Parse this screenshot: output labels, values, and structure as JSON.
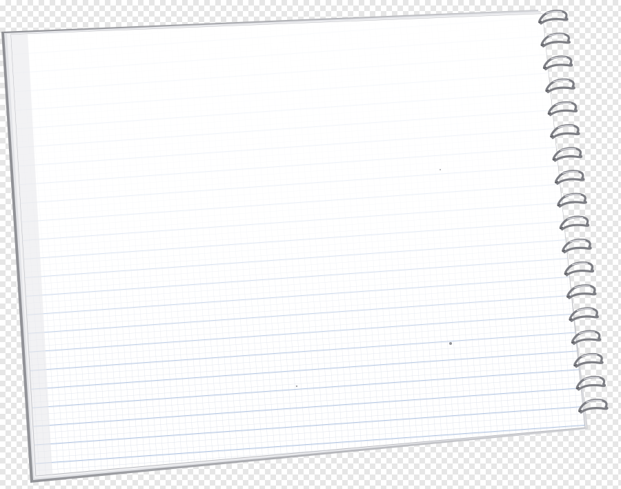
{
  "scene": {
    "subject": "spiral-notebook",
    "page_style": "blue-ruled-grid",
    "binding": "wire-spiral-right",
    "colors": {
      "paper": "#ffffff",
      "paper_shadow": "#d9dadf",
      "page_edge": "#9a9ba0",
      "ruled_line": "#a9bfe0",
      "grid_line": "#d4dae6",
      "wire": "#7d7e84",
      "wire_highlight": "#e8e8ee",
      "background_checker": "#e6e6e6"
    }
  }
}
